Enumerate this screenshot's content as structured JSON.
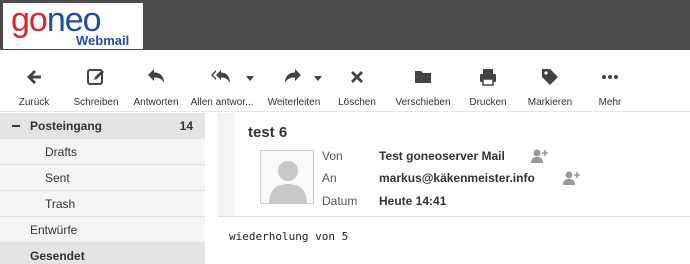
{
  "logo": {
    "part1": "go",
    "part2": "neo",
    "sub": "Webmail"
  },
  "toolbar": {
    "back": "Zurück",
    "compose": "Schreiben",
    "reply": "Antworten",
    "reply_all": "Allen antwor...",
    "forward": "Weiterleiten",
    "delete": "Löschen",
    "move": "Verschieben",
    "print": "Drucken",
    "mark": "Markieren",
    "more": "Mehr"
  },
  "sidebar": {
    "inbox": {
      "label": "Posteingang",
      "count": "14"
    },
    "subfolders": [
      "Drafts",
      "Sent",
      "Trash"
    ],
    "drafts_label": "Entwürfe",
    "sent_label": "Gesendet"
  },
  "message": {
    "subject": "test 6",
    "from_label": "Von",
    "from_value": "Test goneoserver Mail",
    "to_label": "An",
    "to_value": "markus@käkenmeister.info",
    "date_label": "Datum",
    "date_value": "Heute 14:41",
    "body": "wiederholung von 5"
  },
  "colors": {
    "header_bg": "#4b4b4b",
    "logo_red": "#d8262e",
    "logo_blue": "#1f4fa1",
    "sidebar_bg": "#f4f4f4",
    "selected_bg": "#e4e4e4"
  }
}
